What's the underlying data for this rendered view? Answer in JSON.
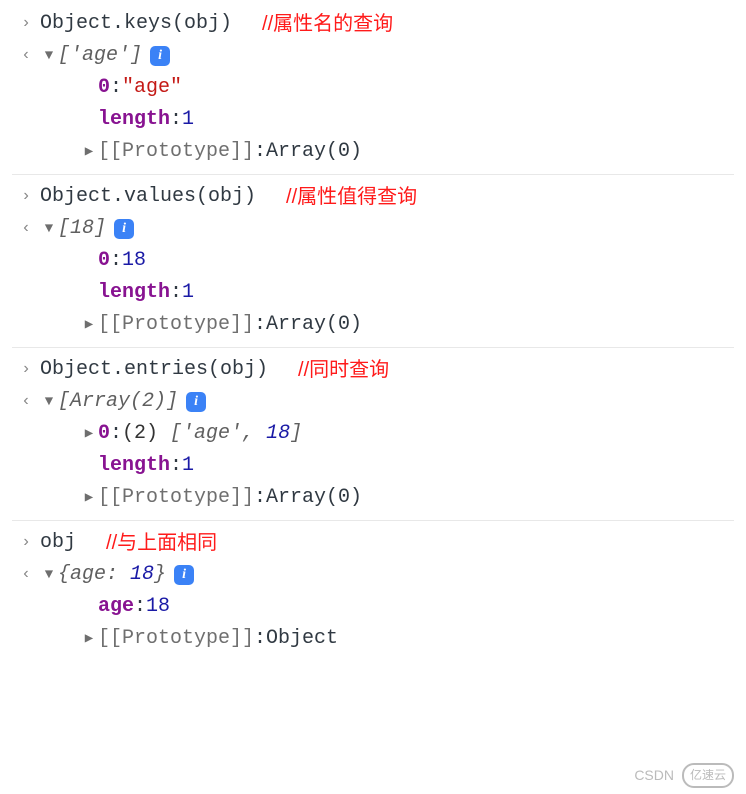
{
  "blocks": [
    {
      "input": "Object.keys(obj)",
      "comment": "//属性名的查询",
      "summary_html": "<span class='gray italic'>['age']</span>",
      "rows": [
        {
          "type": "kv",
          "key": "0",
          "value_html": "<span class='str'>\"age\"</span>"
        },
        {
          "type": "kv",
          "key": "length",
          "value_html": "<span class='blue'>1</span>"
        },
        {
          "type": "proto",
          "label": "[[Prototype]]",
          "value": "Array(0)"
        }
      ]
    },
    {
      "input": "Object.values(obj)",
      "comment": "//属性值得查询",
      "summary_html": "<span class='gray italic'>[18]</span>",
      "rows": [
        {
          "type": "kv",
          "key": "0",
          "value_html": "<span class='blue'>18</span>"
        },
        {
          "type": "kv",
          "key": "length",
          "value_html": "<span class='blue'>1</span>"
        },
        {
          "type": "proto",
          "label": "[[Prototype]]",
          "value": "Array(0)"
        }
      ]
    },
    {
      "input": "Object.entries(obj)",
      "comment": "//同时查询",
      "summary_html": "<span class='gray italic'>[Array(2)]</span>",
      "rows": [
        {
          "type": "expand",
          "key": "0",
          "value_html": "(2) <span class='gray italic'>['age', <span class='blue'>18</span>]</span>"
        },
        {
          "type": "kv",
          "key": "length",
          "value_html": "<span class='blue'>1</span>"
        },
        {
          "type": "proto",
          "label": "[[Prototype]]",
          "value": "Array(0)"
        }
      ]
    },
    {
      "input": "obj",
      "comment": "//与上面相同",
      "summary_html": "<span class='gray italic'>{age: <span class='blue'>18</span>}</span>",
      "rows": [
        {
          "type": "kv",
          "key": "age",
          "value_html": "<span class='blue'>18</span>"
        },
        {
          "type": "proto",
          "label": "[[Prototype]]",
          "value": "Object"
        }
      ]
    }
  ],
  "watermark": {
    "left": "CSDN",
    "right": "亿速云"
  },
  "glyphs": {
    "input": "›",
    "output": "‹",
    "down": "▼",
    "right": "▶",
    "info": "i"
  }
}
